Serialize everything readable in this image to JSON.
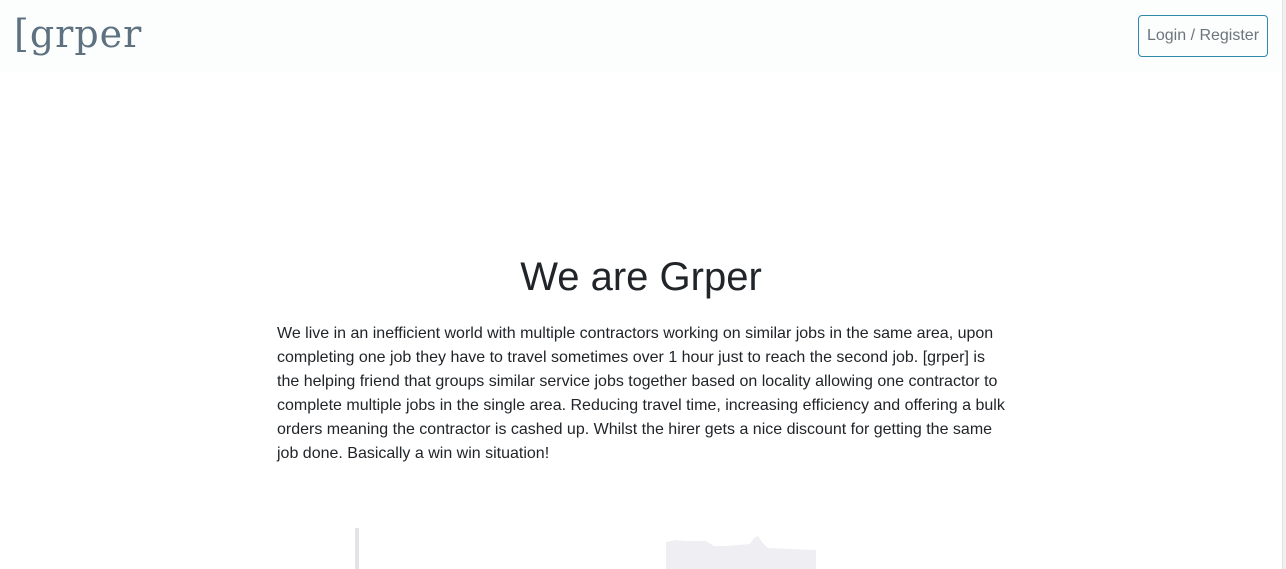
{
  "header": {
    "brand": "[grper",
    "login_register_label": "Login / Register"
  },
  "hero": {
    "title": "We are Grper",
    "description": "We live in an inefficient world with multiple contractors working on similar jobs in the same area, upon completing one job they have to travel sometimes over 1 hour just to reach the second job. [grper] is the helping friend that groups similar service jobs together based on locality allowing one contractor to complete multiple jobs in the single area. Reducing travel time, increasing efficiency and offering a bulk orders meaning the contractor is cashed up. Whilst the hirer gets a nice discount for getting the same job done. Basically a win win situation!"
  },
  "colors": {
    "brand": "#5e7180",
    "button_border": "#2d8aa8",
    "button_text": "#6c757d",
    "text": "#212529",
    "illustration": "#efeef2"
  }
}
